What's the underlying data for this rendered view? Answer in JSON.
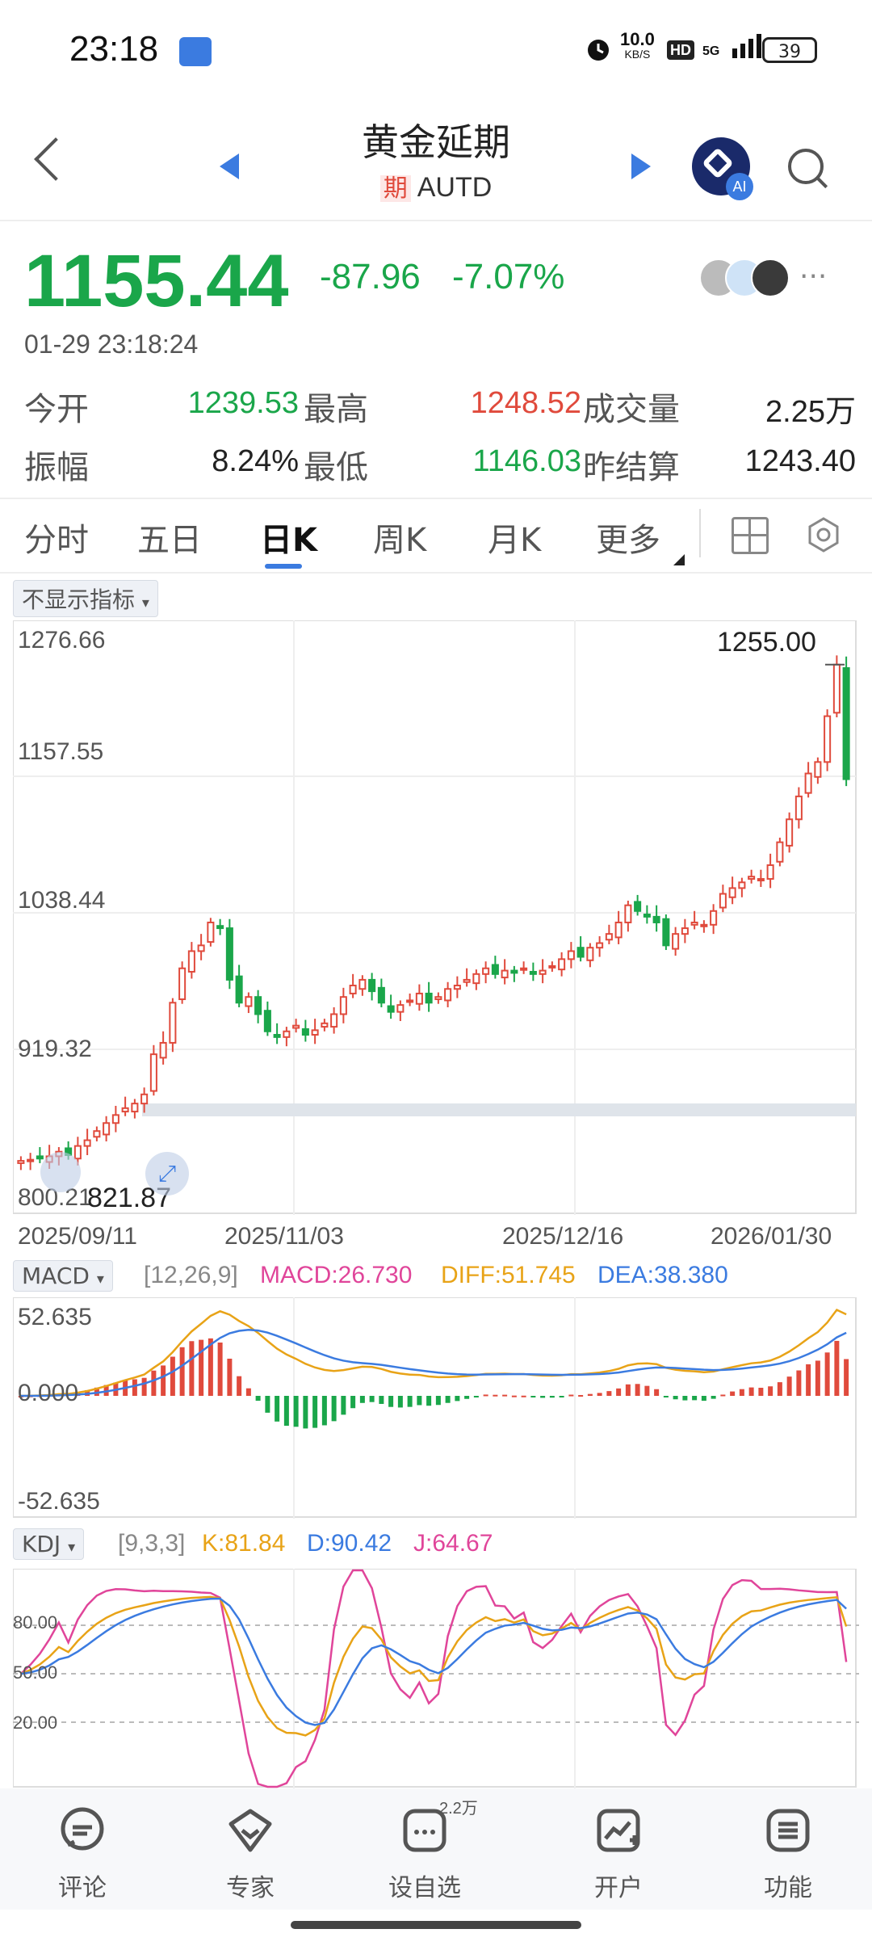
{
  "status_bar": {
    "time": "23:18",
    "net_speed": "10.0",
    "net_unit": "KB/S",
    "hd": "HD",
    "network": "5G",
    "battery": "39"
  },
  "header": {
    "title": "黄金延期",
    "tag": "期",
    "code": "AUTD"
  },
  "ai_badge": "AI",
  "quote": {
    "price": "1155.44",
    "change": "-87.96",
    "change_pct": "-7.07%",
    "timestamp": "01-29 23:18:24",
    "color_down": "#1aa64a",
    "color_up": "#e04a3c",
    "items": [
      {
        "label": "今开",
        "value": "1239.53",
        "color": "#1aa64a"
      },
      {
        "label": "最高",
        "value": "1248.52",
        "color": "#e04a3c"
      },
      {
        "label": "成交量",
        "value": "2.25万",
        "color": "#222"
      },
      {
        "label": "振幅",
        "value": "8.24%",
        "color": "#222"
      },
      {
        "label": "最低",
        "value": "1146.03",
        "color": "#1aa64a"
      },
      {
        "label": "昨结算",
        "value": "1243.40",
        "color": "#222"
      }
    ]
  },
  "tabs": {
    "t1": "分时",
    "t2": "五日",
    "t3": "日K",
    "t4": "周K",
    "t5": "月K",
    "t6": "更多"
  },
  "indicator_toggle": "不显示指标",
  "macd": {
    "name": "MACD",
    "params": "[12,26,9]",
    "macd": "MACD:26.730",
    "diff": "DIFF:51.745",
    "dea": "DEA:38.380"
  },
  "kdj": {
    "name": "KDJ",
    "params": "[9,3,3]",
    "k": "K:81.84",
    "d": "D:90.42",
    "j": "J:64.67"
  },
  "bottom_nav": {
    "comment": "评论",
    "expert": "专家",
    "watch": "设自选",
    "watch_count": "2.2万",
    "open": "开户",
    "func": "功能"
  },
  "chart_data": [
    {
      "type": "candlestick",
      "y_ticks": [
        "1276.66",
        "1157.55",
        "1038.44",
        "919.32",
        "800.21"
      ],
      "ylim": [
        800.21,
        1276.66
      ],
      "x_ticks": [
        "2025/09/11",
        "2025/11/03",
        "2025/12/16",
        "2026/01/30"
      ],
      "annotations": {
        "high": "1255.00",
        "low": "821.87"
      },
      "close": [
        822,
        823,
        824,
        826,
        830,
        827,
        835,
        840,
        848,
        855,
        862,
        868,
        872,
        880,
        915,
        925,
        960,
        990,
        1005,
        1010,
        1030,
        1025,
        980,
        960,
        965,
        950,
        935,
        930,
        935,
        940,
        932,
        936,
        942,
        950,
        965,
        975,
        980,
        970,
        960,
        952,
        958,
        962,
        968,
        960,
        965,
        972,
        975,
        980,
        985,
        990,
        985,
        988,
        986,
        990,
        985,
        988,
        992,
        998,
        1005,
        1000,
        1008,
        1012,
        1020,
        1030,
        1045,
        1040,
        1035,
        1030,
        1010,
        1020,
        1025,
        1030,
        1028,
        1040,
        1055,
        1060,
        1065,
        1070,
        1068,
        1080,
        1100,
        1120,
        1140,
        1160,
        1170,
        1210,
        1255,
        1155
      ],
      "colors": {
        "up": "#e04a3c",
        "down": "#1aa64a"
      }
    },
    {
      "type": "bar",
      "name": "MACD",
      "ylim": [
        -52.635,
        52.635
      ],
      "y_ticks": [
        "52.635",
        "0.000",
        "-52.635"
      ]
    },
    {
      "type": "line",
      "name": "KDJ",
      "y_ticks": [
        "80.00",
        "50.00",
        "20.00"
      ]
    }
  ]
}
